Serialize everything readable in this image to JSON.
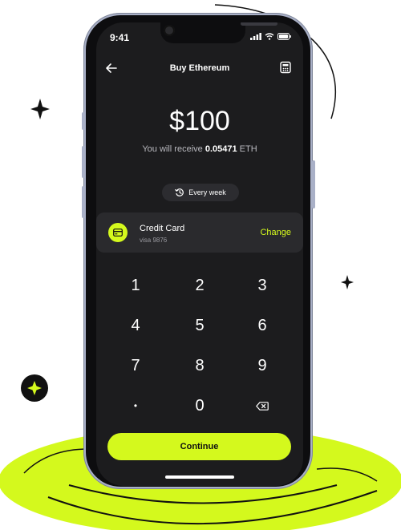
{
  "status_bar": {
    "time": "9:41"
  },
  "header": {
    "title": "Buy Ethereum"
  },
  "purchase": {
    "amount": "$100",
    "receive_prefix": "You will receive",
    "receive_amount": "0.05471",
    "receive_unit": "ETH"
  },
  "frequency": {
    "label": "Every week"
  },
  "payment_method": {
    "title": "Credit Card",
    "subtitle": "visa 9876",
    "change_label": "Change"
  },
  "keypad": {
    "keys": [
      "1",
      "2",
      "3",
      "4",
      "5",
      "6",
      "7",
      "8",
      "9",
      "•",
      "0",
      "backspace-icon"
    ]
  },
  "actions": {
    "continue_label": "Continue"
  },
  "colors": {
    "accent": "#d4f91d",
    "screen_bg": "#1c1c1e",
    "surface": "#2a2a2d"
  }
}
